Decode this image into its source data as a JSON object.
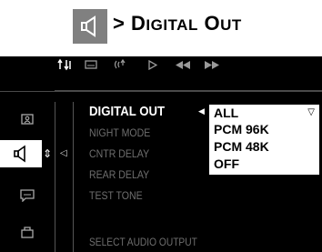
{
  "header": {
    "icon": "speaker-icon",
    "breadcrumb_sep": ">",
    "title_initial_1": "D",
    "title_rest_1": "IGITAL",
    "title_initial_2": "O",
    "title_rest_2": "UT"
  },
  "topbar": {
    "tabs": [
      {
        "icon": "tools-icon",
        "glyph": "⇅"
      },
      {
        "icon": "subtitle-icon",
        "glyph": "▭"
      },
      {
        "icon": "audio-wave-icon",
        "glyph": "((•"
      },
      {
        "icon": "play-icon",
        "glyph": "▷"
      },
      {
        "icon": "rewind-icon",
        "glyph": "◀◀"
      },
      {
        "icon": "fast-forward-icon",
        "glyph": "▶▶"
      }
    ]
  },
  "sidebar": {
    "items": [
      {
        "icon": "picture-icon"
      },
      {
        "icon": "speaker-icon"
      },
      {
        "icon": "subtitle-icon"
      },
      {
        "icon": "lock-icon"
      }
    ]
  },
  "menu": {
    "items": [
      "DIGITAL OUT",
      "NIGHT MODE",
      "CNTR DELAY",
      "REAR DELAY",
      "TEST TONE"
    ],
    "active_index": 0
  },
  "dropdown": {
    "options": [
      "ALL",
      "PCM 96K",
      "PCM 48K",
      "OFF"
    ],
    "selected": "ALL"
  },
  "status_text": "SELECT AUDIO OUTPUT",
  "colors": {
    "osd_background": "#000000",
    "inactive_text": "#6f6f6f",
    "header_icon_box": "#808080"
  }
}
